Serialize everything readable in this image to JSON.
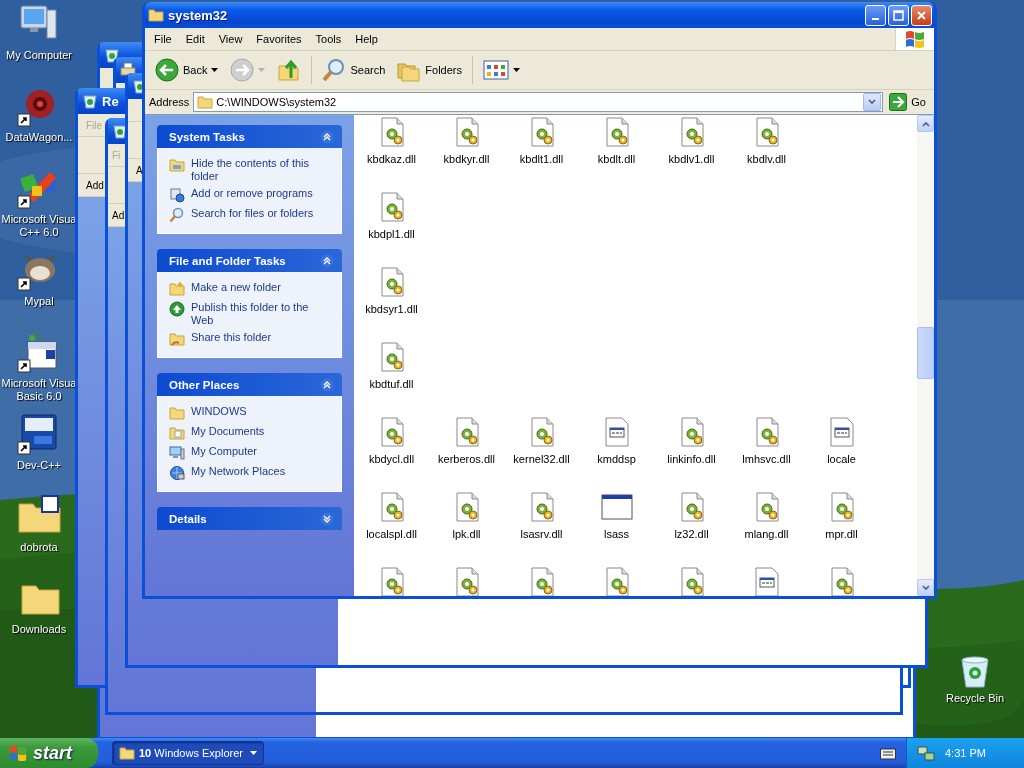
{
  "desktop_icons": [
    {
      "label": "My Computer",
      "kind": "computer",
      "shortcut": false
    },
    {
      "label": "DataWagon...",
      "kind": "flower",
      "shortcut": true
    },
    {
      "label": "Microsoft Visua\nC++ 6.0",
      "kind": "studio",
      "shortcut": true
    },
    {
      "label": "Mypal",
      "kind": "animal",
      "shortcut": true
    },
    {
      "label": "Microsoft Visua\nBasic 6.0",
      "kind": "basic",
      "shortcut": true
    },
    {
      "label": "Dev-C++",
      "kind": "devbox",
      "shortcut": true
    },
    {
      "label": "dobrota",
      "kind": "badgefolder",
      "shortcut": false
    },
    {
      "label": "Downloads",
      "kind": "folder",
      "shortcut": false
    }
  ],
  "recycle_bin": {
    "label": "Recycle Bin"
  },
  "background_windows": [
    {
      "kind": "recycle"
    },
    {
      "kind": "printer"
    },
    {
      "kind": "recycle",
      "title": "Re",
      "menu": "File",
      "address": "Add"
    },
    {
      "kind": "recycle",
      "menu": "Fi",
      "address": "Ad"
    },
    {
      "kind": "recycle",
      "address": "A"
    }
  ],
  "window": {
    "title": "system32",
    "menu": [
      "File",
      "Edit",
      "View",
      "Favorites",
      "Tools",
      "Help"
    ],
    "toolbar": {
      "back": "Back",
      "search": "Search",
      "folders": "Folders",
      "forward_disabled": true
    },
    "address": {
      "label": "Address",
      "value": "C:\\WINDOWS\\system32",
      "go": "Go"
    },
    "task_pane": [
      {
        "title": "System Tasks",
        "expanded": true,
        "items": [
          {
            "label": "Hide the contents of this folder",
            "kind": "hide"
          },
          {
            "label": "Add or remove programs",
            "kind": "programs"
          },
          {
            "label": "Search for files or folders",
            "kind": "search"
          }
        ]
      },
      {
        "title": "File and Folder Tasks",
        "expanded": true,
        "items": [
          {
            "label": "Make a new folder",
            "kind": "newfolder"
          },
          {
            "label": "Publish this folder to the Web",
            "kind": "publish"
          },
          {
            "label": "Share this folder",
            "kind": "share"
          }
        ]
      },
      {
        "title": "Other Places",
        "expanded": true,
        "items": [
          {
            "label": "WINDOWS",
            "kind": "folder"
          },
          {
            "label": "My Documents",
            "kind": "documents"
          },
          {
            "label": "My Computer",
            "kind": "computer"
          },
          {
            "label": "My Network Places",
            "kind": "network"
          }
        ]
      },
      {
        "title": "Details",
        "expanded": false
      }
    ],
    "files": [
      [
        {
          "name": "kbdkaz.dll",
          "kind": "dll"
        },
        {
          "name": "kbdkyr.dll",
          "kind": "dll"
        },
        {
          "name": "kbdlt1.dll",
          "kind": "dll"
        },
        {
          "name": "kbdlt.dll",
          "kind": "dll"
        },
        {
          "name": "kbdlv1.dll",
          "kind": "dll"
        },
        {
          "name": "kbdlv.dll",
          "kind": "dll"
        }
      ],
      [
        {
          "name": "kbdpl1.dll",
          "kind": "dll"
        }
      ],
      [
        {
          "name": "kbdsyr1.dll",
          "kind": "dll"
        }
      ],
      [
        {
          "name": "kbdtuf.dll",
          "kind": "dll"
        }
      ],
      [
        {
          "name": "kbdycl.dll",
          "kind": "dll"
        },
        {
          "name": "kerberos.dll",
          "kind": "dll"
        },
        {
          "name": "kernel32.dll",
          "kind": "dll"
        },
        {
          "name": "kmddsp",
          "kind": "sys"
        },
        {
          "name": "linkinfo.dll",
          "kind": "dll"
        },
        {
          "name": "lmhsvc.dll",
          "kind": "dll"
        },
        {
          "name": "locale",
          "kind": "sys"
        }
      ],
      [
        {
          "name": "localspl.dll",
          "kind": "dll"
        },
        {
          "name": "lpk.dll",
          "kind": "dll"
        },
        {
          "name": "lsasrv.dll",
          "kind": "dll"
        },
        {
          "name": "lsass",
          "kind": "exe"
        },
        {
          "name": "lz32.dll",
          "kind": "dll"
        },
        {
          "name": "mlang.dll",
          "kind": "dll"
        },
        {
          "name": "mpr.dll",
          "kind": "dll"
        }
      ],
      [
        {
          "kind": "dll"
        },
        {
          "kind": "dll"
        },
        {
          "kind": "dll"
        },
        {
          "kind": "dll"
        },
        {
          "kind": "dll"
        },
        {
          "kind": "sys"
        },
        {
          "kind": "dll"
        }
      ]
    ]
  },
  "taskbar": {
    "start": "start",
    "task": "**10** Windows Explorer",
    "clock": "4:31 PM"
  }
}
